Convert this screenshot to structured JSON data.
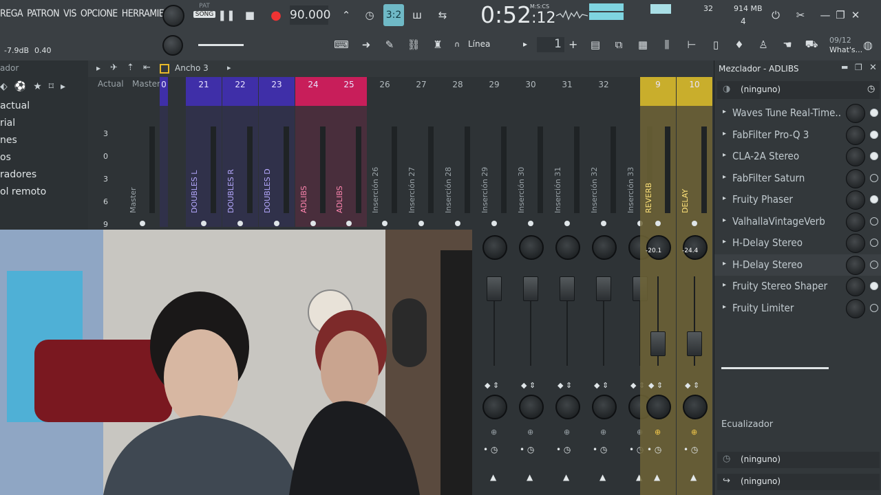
{
  "menu": [
    "REGA",
    "PATRON",
    "VIS",
    "OPCIONE",
    "HERRAMIENTA"
  ],
  "transport": {
    "pat_label": "PAT",
    "song_label": "SONG",
    "tempo": "90.000",
    "time_main": "0:52",
    "time_sub": ":12",
    "time_unit": "M:S:CS",
    "snap_label": "3:2",
    "memory": "914 MB",
    "cpu_num": "32",
    "voices": "4",
    "volume_readout": "-7.9dB",
    "pitch_readout": "0.40",
    "pattern_num": "1",
    "linea_label": "Línea",
    "news_date": "09/12",
    "news_label": "What's..."
  },
  "browser": {
    "title": "ador",
    "items": [
      " actual",
      "rial",
      "nes",
      "os",
      "radores",
      "ol remoto"
    ]
  },
  "mixer": {
    "header_label": "Ancho 3",
    "col_actual": "Actual",
    "col_master": "Master",
    "scale": [
      "3",
      "0",
      "3",
      "6",
      "9"
    ],
    "strips": [
      {
        "num": "",
        "label": "Master",
        "color": "#3a3f42"
      },
      {
        "num": "0",
        "label": "",
        "color": "#3f2fa8"
      },
      {
        "num": "21",
        "label": "DOUBLES L",
        "color": "#3f2fa8"
      },
      {
        "num": "22",
        "label": "DOUBLES R",
        "color": "#3f2fa8"
      },
      {
        "num": "23",
        "label": "DOUBLES D",
        "color": "#3f2fa8"
      },
      {
        "num": "24",
        "label": "ADLIBS",
        "color": "#c81e5a"
      },
      {
        "num": "25",
        "label": "ADLIBS",
        "color": "#c81e5a"
      },
      {
        "num": "26",
        "label": "Inserción 26",
        "color": "#3a3f42"
      },
      {
        "num": "27",
        "label": "Inserción 27",
        "color": "#3a3f42"
      },
      {
        "num": "28",
        "label": "Inserción 28",
        "color": "#3a3f42"
      },
      {
        "num": "29",
        "label": "Inserción 29",
        "color": "#3a3f42"
      },
      {
        "num": "30",
        "label": "Inserción 30",
        "color": "#3a3f42"
      },
      {
        "num": "31",
        "label": "Inserción 31",
        "color": "#3a3f42"
      },
      {
        "num": "32",
        "label": "Inserción 32",
        "color": "#3a3f42"
      },
      {
        "num": "",
        "label": "Inserción 33",
        "color": "#3a3f42"
      },
      {
        "num": "9",
        "label": "REVERB",
        "color": "#c9ae2c"
      },
      {
        "num": "10",
        "label": "DELAY",
        "color": "#c9ae2c"
      }
    ],
    "reverb_level": "-20.1",
    "delay_level": "-24.4"
  },
  "fx": {
    "title": "Mezclador - ADLIBS",
    "input": "(ninguno)",
    "slots": [
      "Waves Tune Real-Time..",
      "FabFilter Pro-Q 3",
      "CLA-2A Stereo",
      "FabFilter Saturn",
      "Fruity Phaser",
      "ValhallaVintageVerb",
      "H-Delay Stereo",
      "H-Delay Stereo",
      "Fruity Stereo Shaper",
      "Fruity Limiter"
    ],
    "eq_label": "Ecualizador",
    "out1": "(ninguno)",
    "out2": "(ninguno)"
  },
  "colors": {
    "blue_group": "#3f2fa8",
    "pink_group": "#c81e5a",
    "gold_group": "#c9ae2c",
    "accent_cyan": "#7fd4e0"
  }
}
